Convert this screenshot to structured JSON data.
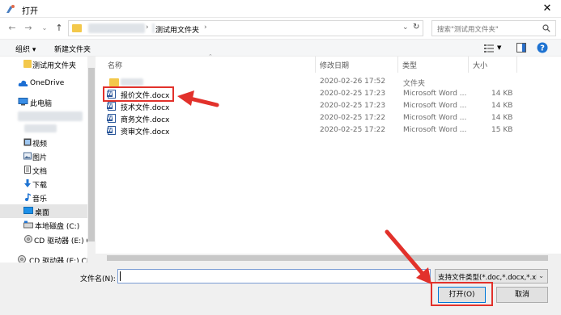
{
  "window": {
    "title": "打开",
    "close_glyph": "✕"
  },
  "address": {
    "path": [
      "测试用文件夹"
    ],
    "separator": "›",
    "refresh_glyph": "↻"
  },
  "search": {
    "placeholder": "搜索\"测试用文件夹\""
  },
  "toolbar": {
    "organize": "组织 ▾",
    "new_folder": "新建文件夹",
    "help_glyph": "?"
  },
  "sidebar": {
    "items": [
      {
        "label": "测试用文件夹",
        "icon": "folder-icon"
      },
      {
        "label": "OneDrive",
        "icon": "cloud-icon"
      },
      {
        "label": "此电脑",
        "icon": "computer-icon"
      },
      {
        "label": "视频",
        "icon": "video-icon"
      },
      {
        "label": "图片",
        "icon": "picture-icon"
      },
      {
        "label": "文档",
        "icon": "document-icon"
      },
      {
        "label": "下载",
        "icon": "download-icon"
      },
      {
        "label": "音乐",
        "icon": "music-icon"
      },
      {
        "label": "桌面",
        "icon": "desktop-icon"
      },
      {
        "label": "本地磁盘 (C:)",
        "icon": "disk-icon"
      },
      {
        "label": "CD 驱动器 (E:) C",
        "icon": "cd-icon"
      },
      {
        "label": "CD 驱动器 (E:) CI",
        "icon": "cd-icon"
      }
    ]
  },
  "columns": {
    "name": "名称",
    "date": "修改日期",
    "type": "类型",
    "size": "大小"
  },
  "files": [
    {
      "name": "",
      "date": "2020-02-26 17:52",
      "type": "文件夹",
      "size": ""
    },
    {
      "name": "报价文件.docx",
      "date": "2020-02-25 17:23",
      "type": "Microsoft Word ...",
      "size": "14 KB"
    },
    {
      "name": "技术文件.docx",
      "date": "2020-02-25 17:23",
      "type": "Microsoft Word ...",
      "size": "14 KB"
    },
    {
      "name": "商务文件.docx",
      "date": "2020-02-25 17:22",
      "type": "Microsoft Word ...",
      "size": "14 KB"
    },
    {
      "name": "资审文件.docx",
      "date": "2020-02-25 17:22",
      "type": "Microsoft Word ...",
      "size": "15 KB"
    }
  ],
  "footer": {
    "filename_label": "文件名(N):",
    "filename_value": "",
    "filter_value": "支持文件类型(*.doc,*.docx,*.xl",
    "open_button": "打开(O)",
    "cancel_button": "取消"
  },
  "colors": {
    "accent": "#0078d7",
    "highlight": "#e2312b",
    "folder": "#f3c84b",
    "word": "#2b579a"
  }
}
